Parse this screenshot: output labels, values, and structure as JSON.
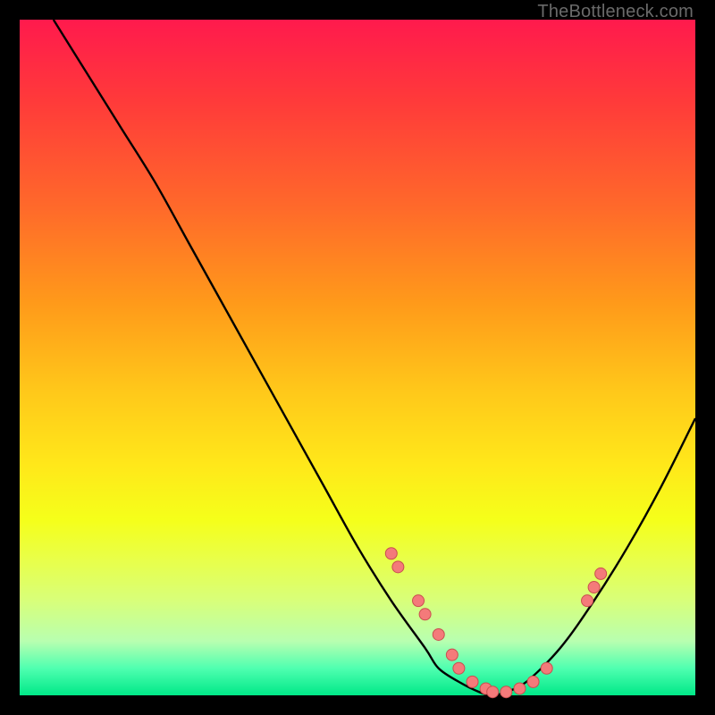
{
  "attribution": "TheBottleneck.com",
  "colors": {
    "frame": "#000000",
    "curve": "#000000",
    "dot_fill": "#f47a7a",
    "dot_stroke": "#c94f4f"
  },
  "chart_data": {
    "type": "line",
    "title": "",
    "xlabel": "",
    "ylabel": "",
    "xlim": [
      0,
      100
    ],
    "ylim": [
      0,
      100
    ],
    "series": [
      {
        "name": "bottleneck-curve",
        "x": [
          5,
          10,
          15,
          20,
          25,
          30,
          35,
          40,
          45,
          50,
          55,
          60,
          62,
          65,
          68,
          70,
          72,
          75,
          80,
          85,
          90,
          95,
          100
        ],
        "y": [
          100,
          92,
          84,
          76,
          67,
          58,
          49,
          40,
          31,
          22,
          14,
          7,
          4,
          2,
          0.5,
          0,
          0.5,
          2,
          7,
          14,
          22,
          31,
          41
        ]
      }
    ],
    "markers": [
      {
        "x": 55,
        "y": 21
      },
      {
        "x": 56,
        "y": 19
      },
      {
        "x": 59,
        "y": 14
      },
      {
        "x": 60,
        "y": 12
      },
      {
        "x": 62,
        "y": 9
      },
      {
        "x": 64,
        "y": 6
      },
      {
        "x": 65,
        "y": 4
      },
      {
        "x": 67,
        "y": 2
      },
      {
        "x": 69,
        "y": 1
      },
      {
        "x": 70,
        "y": 0.5
      },
      {
        "x": 72,
        "y": 0.5
      },
      {
        "x": 74,
        "y": 1
      },
      {
        "x": 76,
        "y": 2
      },
      {
        "x": 78,
        "y": 4
      },
      {
        "x": 84,
        "y": 14
      },
      {
        "x": 85,
        "y": 16
      },
      {
        "x": 86,
        "y": 18
      }
    ]
  }
}
